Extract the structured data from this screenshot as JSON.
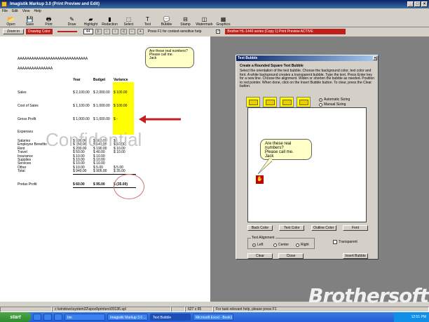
{
  "window": {
    "title": "Imagistik Markup 3.0  (Print Preview and Edit)"
  },
  "menu": [
    "File",
    "Edit",
    "View",
    "Help"
  ],
  "toolbar": [
    {
      "label": "Open",
      "icon": "folder-icon",
      "glyph": "📂"
    },
    {
      "label": "Save",
      "icon": "save-icon",
      "glyph": "💾"
    },
    {
      "label": "Print",
      "icon": "print-icon",
      "glyph": "🖶"
    },
    {
      "label": "Draw",
      "icon": "pencil-icon",
      "glyph": "✎"
    },
    {
      "label": "Highlight",
      "icon": "highlighter-icon",
      "glyph": "▰"
    },
    {
      "label": "Redaction",
      "icon": "redaction-icon",
      "glyph": "▮"
    },
    {
      "label": "Select",
      "icon": "select-icon",
      "glyph": "⬚"
    },
    {
      "label": "Text",
      "icon": "text-icon",
      "glyph": "T"
    },
    {
      "label": "Bubble",
      "icon": "bubble-icon",
      "glyph": "💬"
    },
    {
      "label": "Stamp",
      "icon": "stamp-icon",
      "glyph": "⊟"
    },
    {
      "label": "Watermark",
      "icon": "watermark-icon",
      "glyph": "◫"
    },
    {
      "label": "Graphics",
      "icon": "graphics-icon",
      "glyph": "▦"
    }
  ],
  "toolbar2": {
    "zoom_label": "Zoom in",
    "drawing_color": "Drawing Color",
    "page_num": "44",
    "help_text": "Press F1 for context-sensitive help",
    "printer_status": "Brother HL-1440 series (Copy 1)   Print Preview ACTIVE"
  },
  "document": {
    "header1": "AAAAAAAAAAAAAAAAAAAAAAAAAAAAAA",
    "header2": "AAAAAAAAAAAAAAA",
    "bubble_lines": [
      "Are these real numbers?",
      "Please call me.",
      "Jack"
    ],
    "columns": [
      "Year",
      "Budget",
      "Variance"
    ],
    "rows": [
      {
        "label": "Sales",
        "year": "$ 2,100.00",
        "budget": "$ 2,000.00",
        "var": "$  100.00"
      },
      {
        "label": "Cost of Sales",
        "year": "$ 1,100.00",
        "budget": "$ 1,000.00",
        "var": "$  100.00"
      },
      {
        "label": "Gross Profit",
        "year": "$ 1,000.00",
        "budget": "$ 1,000.00",
        "var": "$      -"
      }
    ],
    "expenses_title": "Expenses",
    "expenses": [
      {
        "label": "Salaries",
        "year": "$   500.00",
        "budget": "$   500.00",
        "var": "$     -"
      },
      {
        "label": "Employee Benefits",
        "year": "$   150.00",
        "budget": "$   140.00",
        "var": "$   10.00"
      },
      {
        "label": "Rent",
        "year": "$   200.00",
        "budget": "$   190.00",
        "var": "$   10.00"
      },
      {
        "label": "Travel",
        "year": "$    50.00",
        "budget": "$    40.00",
        "var": "$   10.00"
      },
      {
        "label": "Insurance",
        "year": "$    10.00",
        "budget": "$    10.00",
        "var": ""
      },
      {
        "label": "Supplies",
        "year": "$    10.00",
        "budget": "$    10.00",
        "var": ""
      },
      {
        "label": "Services",
        "year": "$    10.00",
        "budget": "$    10.00",
        "var": ""
      },
      {
        "label": "Other",
        "year": "$    10.00",
        "budget": "$     5.00",
        "var": "$    5.00"
      },
      {
        "label": "Total",
        "year": "$   940.00",
        "budget": "$   905.00",
        "var": "$   35.00"
      }
    ],
    "pretax": {
      "label": "Pretax Profit",
      "year": "$    60.00",
      "budget": "$    95.00",
      "var": "$  (35.00)"
    },
    "watermark": "Confidential"
  },
  "dialog": {
    "title": "Text Bubble",
    "heading": "Create a Rounded Square Text Bubble",
    "description": "Select the orientation of the text bubble.  Choose the background color, text color and font.  A white background creates a transparent bubble.  Type the text.  Press Enter key for a new line.  Choose the alignment.  Widen or shorten the bubble as needed. Position to red pointer.  When done, click on the Insert Bubble button. To clear, press the Clear button.",
    "sizing_auto": "Automatic Sizing",
    "sizing_manual": "Manual Sizing",
    "preview_lines": [
      "Are these real numbers?",
      "Please call me.",
      "Jack"
    ],
    "buttons1": [
      "Back Color",
      "Text Color",
      "Outline Color",
      "Font"
    ],
    "alignment_title": "Text Alignment",
    "align_options": [
      "Left",
      "Center",
      "Right"
    ],
    "transparent": "Transparent",
    "clear": "Clear",
    "close": "Close",
    "insert": "Insert Bubble"
  },
  "status": {
    "path": "c:\\windows\\system32\\spool\\printers\\00136.spl",
    "coords": "627 x 65",
    "help": "For task-relevant help, please press F1"
  },
  "taskbar": {
    "start": "start",
    "tasks": [
      "bin",
      "Imagistik Markup 3.0 ...",
      "Text Bubble",
      "Microsoft Excel - Book1"
    ],
    "clock": "12:51 PM"
  },
  "brand": "Brothersoft"
}
